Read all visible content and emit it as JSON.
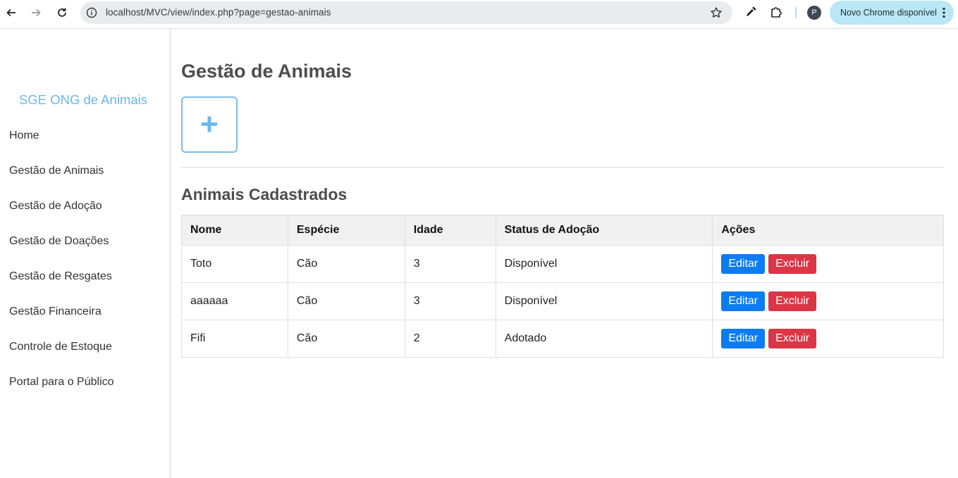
{
  "browser": {
    "url": "localhost/MVC/view/index.php?page=gestao-animais",
    "profile_initial": "P",
    "update_label": "Novo Chrome disponível"
  },
  "sidebar": {
    "brand": "SGE ONG de Animais",
    "items": [
      {
        "label": "Home"
      },
      {
        "label": "Gestão de Animais"
      },
      {
        "label": "Gestão de Adoção"
      },
      {
        "label": "Gestão de Doações"
      },
      {
        "label": "Gestão de Resgates"
      },
      {
        "label": "Gestão Financeira"
      },
      {
        "label": "Controle de Estoque"
      },
      {
        "label": "Portal para o Público"
      }
    ]
  },
  "main": {
    "title": "Gestão de Animais",
    "add_symbol": "+",
    "section_title": "Animais Cadastrados",
    "table": {
      "headers": [
        "Nome",
        "Espécie",
        "Idade",
        "Status de Adoção",
        "Ações"
      ],
      "rows": [
        {
          "nome": "Toto",
          "especie": "Cão",
          "idade": "3",
          "status": "Disponível"
        },
        {
          "nome": "aaaaaa",
          "especie": "Cão",
          "idade": "3",
          "status": "Disponível"
        },
        {
          "nome": "Fifi",
          "especie": "Cão",
          "idade": "2",
          "status": "Adotado"
        }
      ],
      "edit_label": "Editar",
      "delete_label": "Excluir"
    }
  },
  "colors": {
    "brand": "#6ab8ef",
    "edit_button": "#0d7cf2",
    "delete_button": "#dc3545"
  }
}
